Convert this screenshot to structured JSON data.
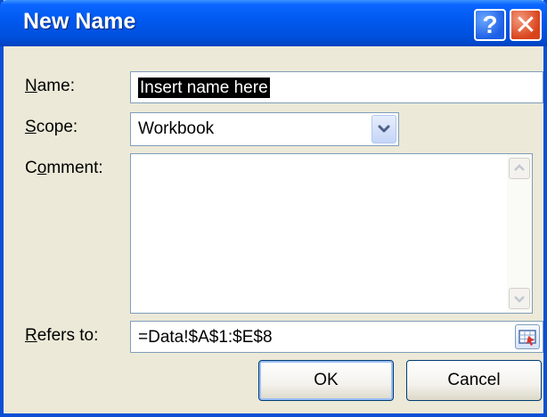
{
  "window": {
    "title": "New Name"
  },
  "title_buttons": {
    "help_glyph": "?",
    "close_glyph": "✕"
  },
  "form": {
    "name_label_key": "N",
    "name_label_rest": "ame:",
    "name_value": "Insert name here",
    "scope_label_key": "S",
    "scope_label_rest": "cope:",
    "scope_value": "Workbook",
    "comment_label_pre": "C",
    "comment_label_key": "o",
    "comment_label_rest": "mment:",
    "comment_value": "",
    "refers_label_key": "R",
    "refers_label_rest": "efers to:",
    "refers_value": "=Data!$A$1:$E$8"
  },
  "buttons": {
    "ok_label": "OK",
    "cancel_label": "Cancel"
  },
  "icons": {
    "dropdown": "chevron-down-icon",
    "scroll_up": "scroll-up-arrow-icon",
    "scroll_down": "scroll-down-arrow-icon",
    "range_select": "range-select-icon"
  }
}
